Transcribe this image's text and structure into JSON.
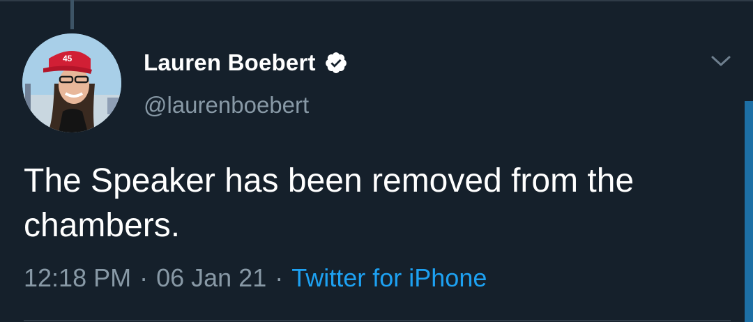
{
  "tweet": {
    "display_name": "Lauren Boebert",
    "handle": "@laurenboebert",
    "verified": true,
    "text": "The Speaker has been removed from the chambers.",
    "time": "12:18 PM",
    "separator_1": "·",
    "date": "06 Jan 21",
    "separator_2": "·",
    "source": "Twitter for iPhone",
    "hat_text": "45"
  },
  "icons": {
    "verified": "verified-badge-icon",
    "menu": "chevron-down-icon"
  },
  "colors": {
    "background": "#15202b",
    "primary_text": "#ffffff",
    "secondary_text": "#8899a6",
    "accent": "#1da1f2",
    "divider": "#2f3b47"
  }
}
